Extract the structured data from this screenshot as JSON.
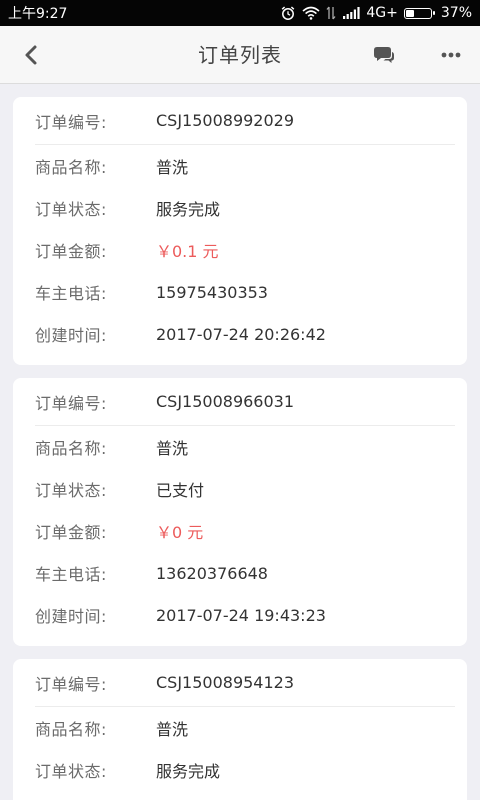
{
  "status_bar": {
    "time": "上午9:27",
    "network": "4G+",
    "battery_percent": "37%",
    "battery_level": 0.37,
    "icons": [
      "alarm-icon",
      "wifi-icon",
      "data-arrows-icon",
      "signal-icon",
      "battery-icon"
    ]
  },
  "nav": {
    "title": "订单列表",
    "back_icon": "chevron-left-icon",
    "chat_icon": "chat-bubbles-icon",
    "more_icon": "more-dots-icon"
  },
  "colors": {
    "amount": "#ec5b5b",
    "label": "#6b6b6b",
    "value": "#333333",
    "background": "#efeff4"
  },
  "orders": [
    {
      "number_label": "订单编号:",
      "number": "CSJ15008992029",
      "product_label": "商品名称:",
      "product": "普洗",
      "status_label": "订单状态:",
      "status": "服务完成",
      "amount_label": "订单金额:",
      "amount": "￥0.1 元",
      "phone_label": "车主电话:",
      "phone": "15975430353",
      "created_label": "创建时间:",
      "created": "2017-07-24 20:26:42"
    },
    {
      "number_label": "订单编号:",
      "number": "CSJ15008966031",
      "product_label": "商品名称:",
      "product": "普洗",
      "status_label": "订单状态:",
      "status": "已支付",
      "amount_label": "订单金额:",
      "amount": "￥0 元",
      "phone_label": "车主电话:",
      "phone": "13620376648",
      "created_label": "创建时间:",
      "created": "2017-07-24 19:43:23"
    },
    {
      "number_label": "订单编号:",
      "number": "CSJ15008954123",
      "product_label": "商品名称:",
      "product": "普洗",
      "status_label": "订单状态:",
      "status": "服务完成"
    }
  ]
}
